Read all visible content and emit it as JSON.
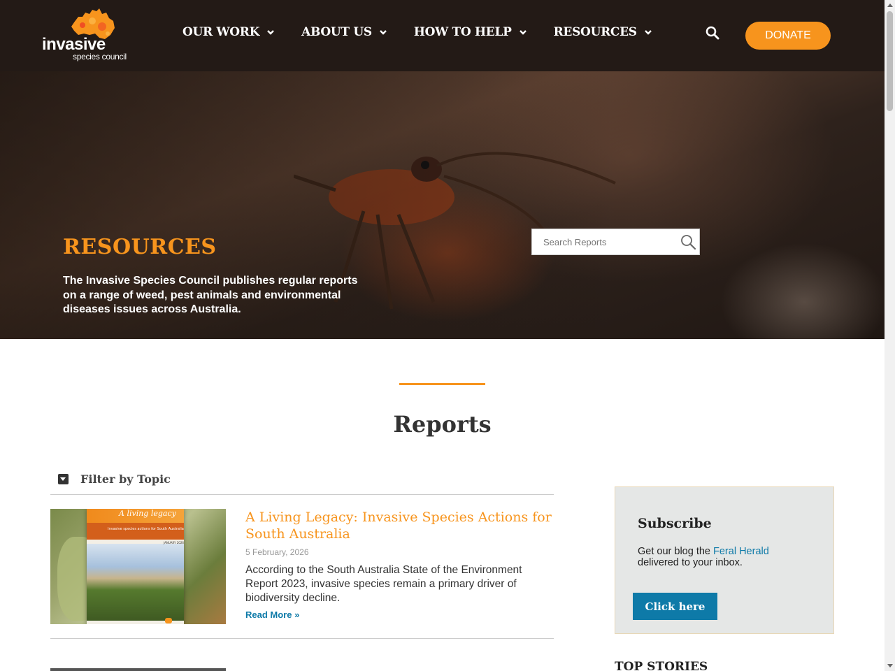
{
  "header": {
    "logo_text": "invasive",
    "logo_sub": "species council",
    "nav": [
      {
        "label": "OUR WORK"
      },
      {
        "label": "ABOUT US"
      },
      {
        "label": "HOW TO HELP"
      },
      {
        "label": "RESOURCES"
      }
    ],
    "donate_label": "DONATE",
    "accent_color": "#f7941d",
    "bg_color": "#231a16"
  },
  "hero": {
    "title": "RESOURCES",
    "description": "The Invasive Species Council publishes regular reports on a range of weed, pest animals and environmental diseases issues across Australia.",
    "search_placeholder": "Search Reports"
  },
  "reports": {
    "heading": "Reports",
    "filter_label": "Filter by Topic",
    "items": [
      {
        "title": "A Living Legacy: Invasive Species Actions for South Australia",
        "date": "5 February, 2026",
        "excerpt": "According to the South Australia State of the Environment Report 2023, invasive species remain a primary driver of biodiversity decline.",
        "read_more": "Read More »",
        "cover": {
          "title": "A living legacy",
          "subtitle": "Invasive species actions for South Australia",
          "date": "JANUARY 2026"
        }
      }
    ]
  },
  "sidebar": {
    "subscribe_title": "Subscribe",
    "subscribe_text_before": "Get our blog the ",
    "subscribe_link": "Feral Herald",
    "subscribe_text_after": " delivered to your inbox.",
    "subscribe_button": "Click here",
    "top_stories": "TOP STORIES"
  }
}
